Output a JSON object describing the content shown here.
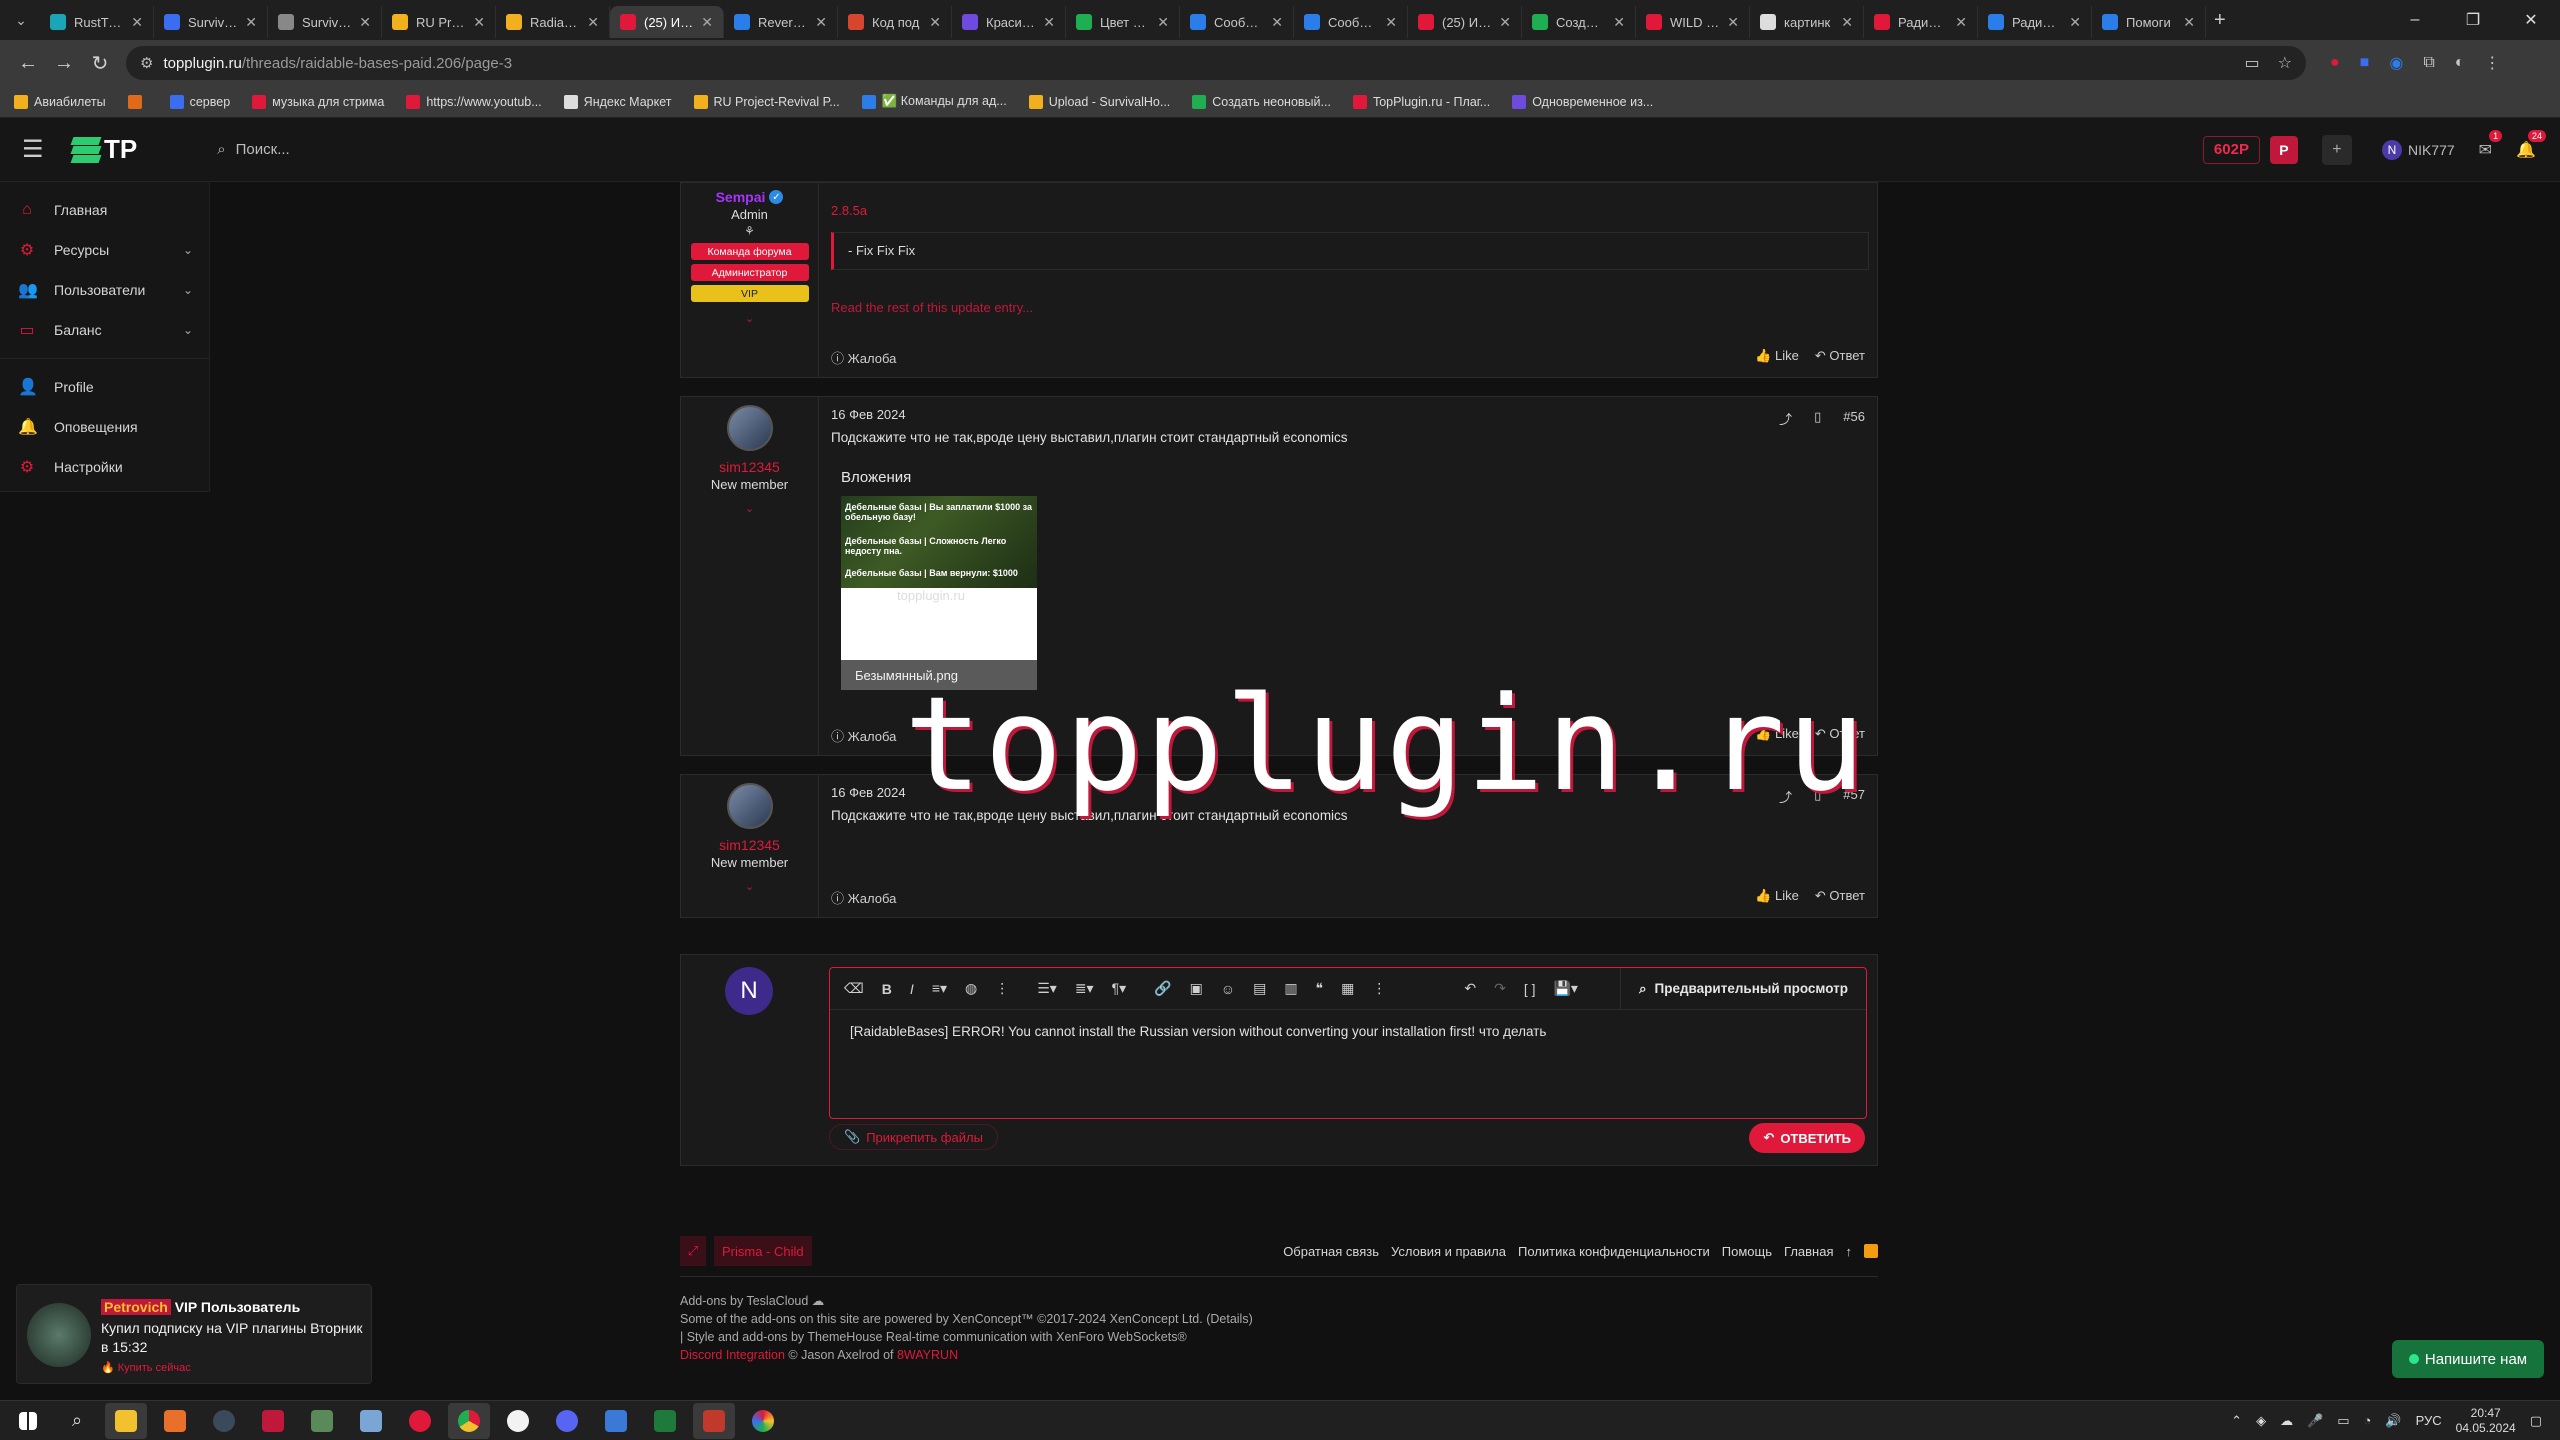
{
  "browser": {
    "tabs": [
      {
        "label": "RustTravi",
        "color": "#1aa6b7"
      },
      {
        "label": "SurvivalH",
        "color": "#3a6df0"
      },
      {
        "label": "SurvivalSe",
        "color": "#888888"
      },
      {
        "label": "RU Projec",
        "color": "#f2b01e"
      },
      {
        "label": "Radiation",
        "color": "#f2b01e"
      },
      {
        "label": "(25) ИВЕ",
        "color": "#e0193a",
        "active": true
      },
      {
        "label": "Reverso |",
        "color": "#2b7de9"
      },
      {
        "label": "Код под",
        "color": "#d6452d"
      },
      {
        "label": "Красивы",
        "color": "#6e4adf"
      },
      {
        "label": "Цвет #20",
        "color": "#1fae52"
      },
      {
        "label": "Сообщен",
        "color": "#2b7de9"
      },
      {
        "label": "Сообщен",
        "color": "#2b7de9"
      },
      {
        "label": "(25) Иве",
        "color": "#e0193a"
      },
      {
        "label": "Создать",
        "color": "#1fae52"
      },
      {
        "label": "WILD RU",
        "color": "#e0193a"
      },
      {
        "label": "картинк",
        "color": "#dddddd"
      },
      {
        "label": "Радиаци",
        "color": "#e0193a"
      },
      {
        "label": "Радиаци",
        "color": "#2b7de9"
      },
      {
        "label": "Помоги",
        "color": "#2b7de9"
      }
    ],
    "url_host": "topplugin.ru",
    "url_path": "/threads/raidable-bases-paid.206/page-3",
    "bookmarks": [
      {
        "label": "Авиабилеты",
        "color": "#f2b01e"
      },
      {
        "label": "",
        "color": "#e06a1a"
      },
      {
        "label": "сервер",
        "color": "#3a6df0"
      },
      {
        "label": "музыка для стрима",
        "color": "#e0193a"
      },
      {
        "label": "https://www.youtub...",
        "color": "#e0193a"
      },
      {
        "label": "Яндекс Маркет",
        "color": "#dddddd"
      },
      {
        "label": "RU Project-Revival P...",
        "color": "#f2b01e"
      },
      {
        "label": "✅ Команды для ад...",
        "color": "#2b7de9"
      },
      {
        "label": "Upload - SurvivalHo...",
        "color": "#f2b01e"
      },
      {
        "label": "Создать неоновый...",
        "color": "#1fae52"
      },
      {
        "label": "TopPlugin.ru - Плаг...",
        "color": "#e0193a"
      },
      {
        "label": "Одновременное из...",
        "color": "#6e4adf"
      }
    ]
  },
  "header": {
    "logo": "TP",
    "search_placeholder": "Поиск...",
    "balance": "602P",
    "p_button": "P",
    "plus": "+",
    "user_initial": "N",
    "username": "NIK777",
    "mail_count": "1",
    "notif_count": "24"
  },
  "sidebar": {
    "items": [
      {
        "label": "Главная",
        "icon": "home-icon"
      },
      {
        "label": "Ресурсы",
        "icon": "resources-icon",
        "chevron": true
      },
      {
        "label": "Пользователи",
        "icon": "users-icon",
        "chevron": true
      },
      {
        "label": "Баланс",
        "icon": "wallet-icon",
        "chevron": true
      }
    ],
    "items2": [
      {
        "label": "Profile",
        "icon": "profile-icon"
      },
      {
        "label": "Оповещения",
        "icon": "bell-icon"
      },
      {
        "label": "Настройки",
        "icon": "gear-icon"
      }
    ]
  },
  "post1": {
    "username": "Sempai",
    "rank": "Admin",
    "ribbons": [
      "Команда форума",
      "Администратор",
      "VIP"
    ],
    "version": "2.8.5a",
    "quote": "- Fix Fix Fix",
    "read_more": "Read the rest of this update entry...",
    "report": "Жалоба",
    "like": "Like",
    "reply": "Ответ"
  },
  "post2": {
    "username": "sim12345",
    "rank": "New member",
    "date": "16 Фев 2024",
    "number": "#56",
    "text": "Подскажите что не так,вроде цену выставил,плагин стоит стандартный economics",
    "attachments_title": "Вложения",
    "thumb_lines": [
      "Дебельные базы | Вы заплатили $1000 за обельную базу!",
      "Дебельные базы | Сложность Легко недосту пна.",
      "Дебельные базы | Вам вернули: $1000"
    ],
    "thumb_wm": "topplugin.ru",
    "filename": "Безымянный.png",
    "report": "Жалоба",
    "like": "Like",
    "reply": "Ответ"
  },
  "post3": {
    "username": "sim12345",
    "rank": "New member",
    "date": "16 Фев 2024",
    "number": "#57",
    "text": "Подскажите что не так,вроде цену выставил,плагин стоит стандартный economics",
    "report": "Жалоба",
    "like": "Like",
    "reply": "Ответ"
  },
  "editor": {
    "avatar_initial": "N",
    "preview_label": "Предварительный просмотр",
    "content": "[RaidableBases] ERROR! You cannot install the Russian version without converting your installation first! что делать",
    "attach_label": "Прикрепить файлы",
    "reply_label": "ОТВЕТИТЬ"
  },
  "footer": {
    "style_chip": "Prisma - Child",
    "links": [
      "Обратная связь",
      "Условия и правила",
      "Политика конфиденциальности",
      "Помощь",
      "Главная"
    ],
    "notes": [
      "Add-ons by TeslaCloud ☁",
      "Some of the add-ons on this site are powered by XenConcept™ ©2017-2024 XenConcept Ltd. (Details)",
      "| Style and add-ons by ThemeHouse Real-time communication with XenForo WebSockets®"
    ],
    "discord_label": "Discord Integration",
    "discord_by": " © Jason Axelrod of ",
    "discord_org": "8WAYRUN"
  },
  "watermark": "topplugin.ru",
  "toast": {
    "name": "Petrovich",
    "title_rest": " VIP Пользователь",
    "body": "Купил подписку на VIP плагины Вторник в 15:32",
    "cta": "🔥 Купить сейчас"
  },
  "chat_button": "Напишите нам",
  "taskbar": {
    "time": "20:47",
    "date": "04.05.2024",
    "lang": "РУС"
  }
}
